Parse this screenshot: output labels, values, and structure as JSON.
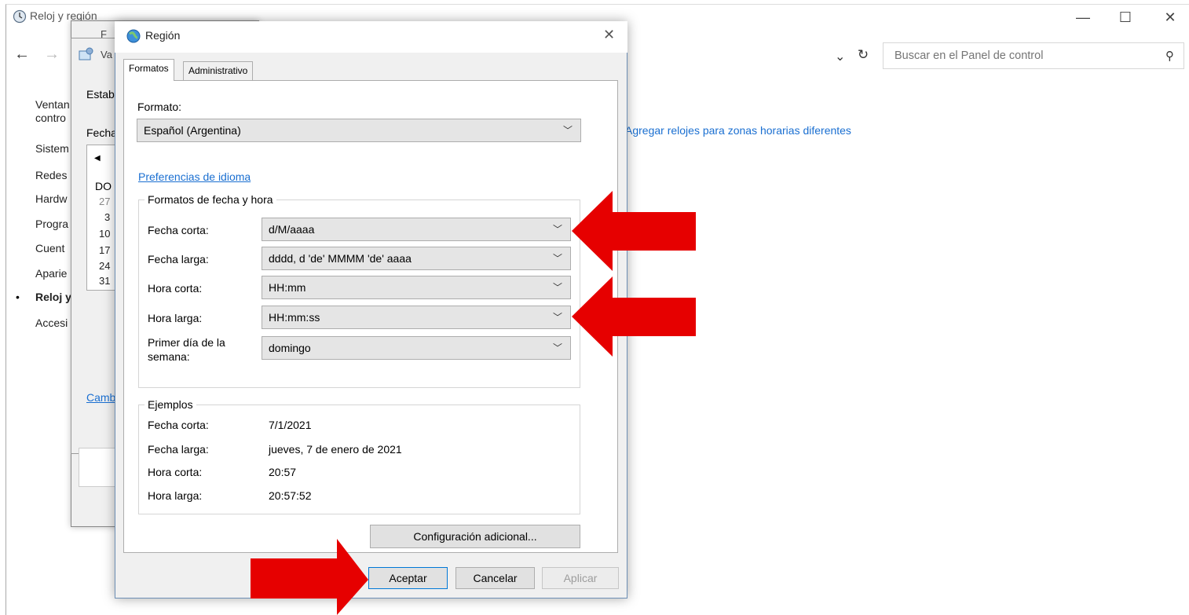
{
  "control_panel": {
    "title": "Reloj y región",
    "search_placeholder": "Buscar en el Panel de control",
    "nav_items": [
      "Ventan",
      "contro",
      "Sistem",
      "Redes",
      "Hardw",
      "Progra",
      "Cuent",
      "Aparie",
      "Reloj y",
      "Accesi"
    ],
    "add_clocks_link": "Agregar relojes para zonas horarias diferentes",
    "caption": {
      "minimize": "—",
      "maximize": "☐",
      "close": "✕"
    }
  },
  "behind_dialogs": {
    "fecha_title": "F",
    "valores_title": "Va",
    "valores_texts": [
      "Estab",
      "Fecha",
      "DO",
      "Camb"
    ],
    "calendar_days": [
      "27",
      "3",
      "10",
      "17",
      "24",
      "31"
    ]
  },
  "region": {
    "title": "Región",
    "tabs": [
      "Formatos",
      "Administrativo"
    ],
    "format_label": "Formato:",
    "format_value": "Español (Argentina)",
    "lang_link": "Preferencias de idioma",
    "formats_group": "Formatos de fecha y hora",
    "fields": [
      {
        "label": "Fecha corta:",
        "value": "d/M/aaaa"
      },
      {
        "label": "Fecha larga:",
        "value": "dddd, d 'de' MMMM 'de' aaaa"
      },
      {
        "label": "Hora corta:",
        "value": "HH:mm"
      },
      {
        "label": "Hora larga:",
        "value": "HH:mm:ss"
      },
      {
        "label": "Primer día de la semana:",
        "value": "domingo"
      }
    ],
    "examples_group": "Ejemplos",
    "examples": [
      {
        "label": "Fecha corta:",
        "value": "7/1/2021"
      },
      {
        "label": "Fecha larga:",
        "value": "jueves, 7 de enero de 2021"
      },
      {
        "label": "Hora corta:",
        "value": "20:57"
      },
      {
        "label": "Hora larga:",
        "value": "20:57:52"
      }
    ],
    "extra_button": "Configuración adicional...",
    "ok_button": "Aceptar",
    "cancel_button": "Cancelar",
    "apply_button": "Aplicar"
  },
  "colors": {
    "arrow": "#e60000",
    "link": "#1a6fd1"
  }
}
